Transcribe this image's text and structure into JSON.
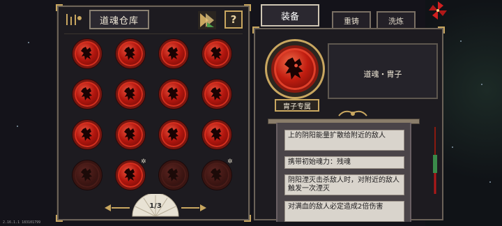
{
  "inventory": {
    "title": "道魂仓库",
    "help_label": "?",
    "page_indicator": "1/3",
    "slots": [
      {
        "state": "owned"
      },
      {
        "state": "owned"
      },
      {
        "state": "owned"
      },
      {
        "state": "owned"
      },
      {
        "state": "owned"
      },
      {
        "state": "owned"
      },
      {
        "state": "owned"
      },
      {
        "state": "owned"
      },
      {
        "state": "owned"
      },
      {
        "state": "owned"
      },
      {
        "state": "owned"
      },
      {
        "state": "owned"
      },
      {
        "state": "locked"
      },
      {
        "state": "owned",
        "star": true
      },
      {
        "state": "locked"
      },
      {
        "state": "locked",
        "star": true
      }
    ]
  },
  "tabs": [
    {
      "label": "装备",
      "active": true
    },
    {
      "label": "重铸",
      "active": false
    },
    {
      "label": "洗炼",
      "active": false
    }
  ],
  "detail": {
    "item_name": "道魂・胄子",
    "exclusive_label": "胄子专属",
    "effects": [
      "上的阴阳能量扩散给附近的敌人",
      "携带初始魂力：残魂",
      "阴阳湮灭击杀敌人时，对附近的敌人触发一次湮灭",
      "对满血的敌人必定造成2倍伤害"
    ]
  },
  "version_text": "2.16.1.1 183101799",
  "colors": {
    "orb_red": "#c11d10",
    "gold_trim": "#c9a760",
    "panel_bg": "#1d1b20"
  }
}
